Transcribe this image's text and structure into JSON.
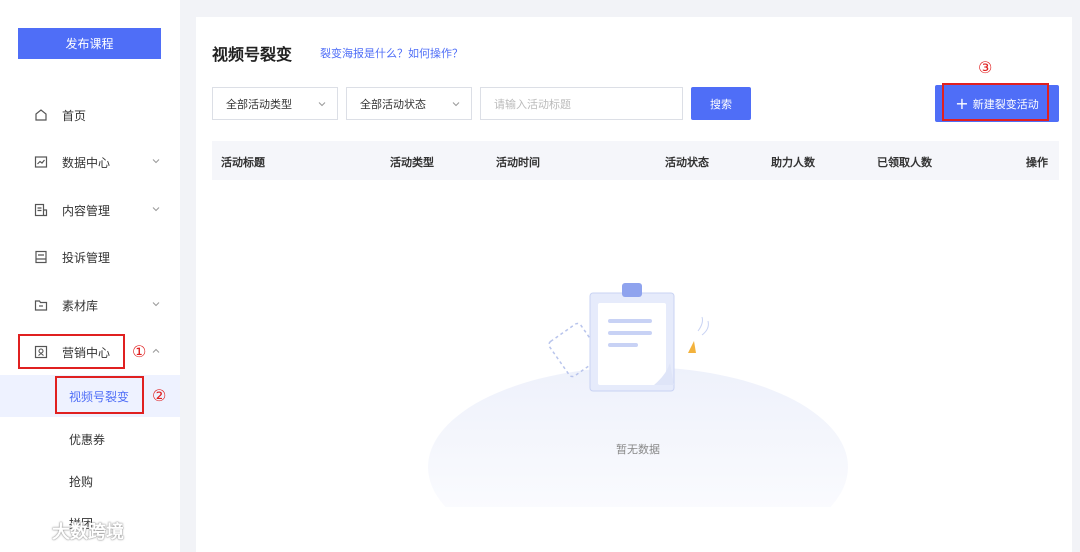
{
  "sidebar": {
    "publish_label": "发布课程",
    "items": [
      {
        "label": "首页",
        "icon": "home-icon"
      },
      {
        "label": "数据中心",
        "icon": "chart-icon"
      },
      {
        "label": "内容管理",
        "icon": "document-icon"
      },
      {
        "label": "投诉管理",
        "icon": "complaint-icon"
      },
      {
        "label": "素材库",
        "icon": "folder-icon"
      },
      {
        "label": "营销中心",
        "icon": "marketing-icon"
      }
    ],
    "sub_items": [
      {
        "label": "视频号裂变"
      },
      {
        "label": "优惠券"
      },
      {
        "label": "抢购"
      },
      {
        "label": "拼团"
      }
    ]
  },
  "annotations": {
    "one": "①",
    "two": "②",
    "three": "③"
  },
  "watermark": "大数跨境",
  "header": {
    "title": "视频号裂变",
    "help_link": "裂变海报是什么？如何操作？"
  },
  "filters": {
    "type_select": "全部活动类型",
    "status_select": "全部活动状态",
    "search_placeholder": "请输入活动标题",
    "search_label": "搜索",
    "new_label": "新建裂变活动"
  },
  "table": {
    "columns": [
      "活动标题",
      "活动类型",
      "活动时间",
      "活动状态",
      "助力人数",
      "已领取人数",
      "操作"
    ]
  },
  "empty": {
    "text": "暂无数据"
  },
  "colors": {
    "accent": "#4f6ef7",
    "annotation": "#e02020"
  }
}
